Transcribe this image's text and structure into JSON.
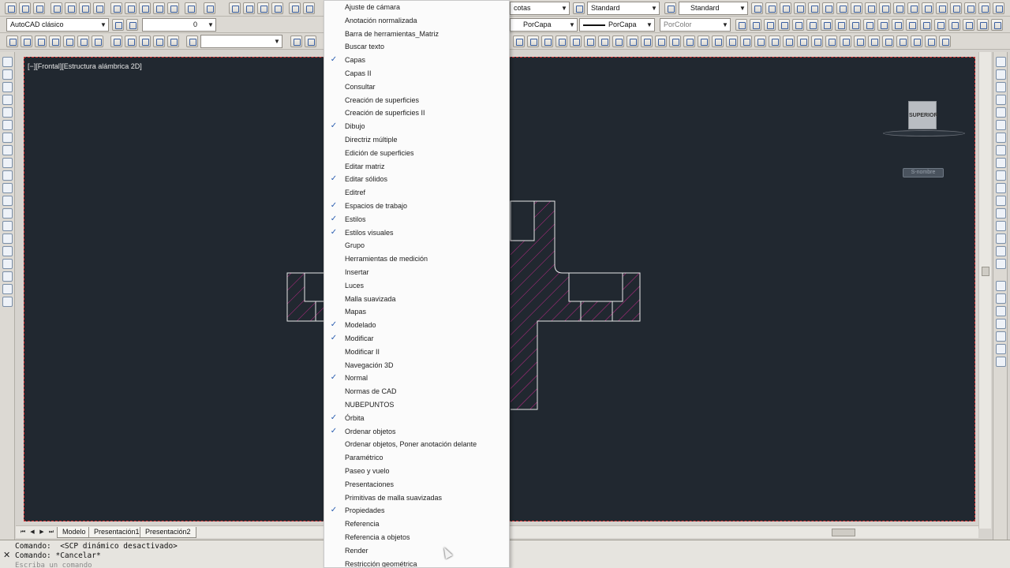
{
  "toolbar": {
    "workspace": "AutoCAD clásico",
    "layer_value": "0",
    "blank_combo": "",
    "text_style": "Standard",
    "dim_style_partial": "cotas",
    "table_style": "Standard",
    "color": "PorCapa",
    "linetype": "PorCapa",
    "lineweight": "PorColor"
  },
  "viewport": {
    "label": "[−][Frontal][Estructura alámbrica 2D]",
    "viewcube_label": "SUPERIOR",
    "wcs_label": "S-nombre"
  },
  "tabs": [
    "Modelo",
    "Presentación1",
    "Presentación2"
  ],
  "command": {
    "line1": "Comando:  <SCP dinámico desactivado>",
    "line2": "Comando: *Cancelar*",
    "placeholder": "Escriba un comando"
  },
  "menu": {
    "items": [
      {
        "label": "Ajuste de cámara",
        "checked": false
      },
      {
        "label": "Anotación normalizada",
        "checked": false
      },
      {
        "label": "Barra de herramientas_Matriz",
        "checked": false
      },
      {
        "label": "Buscar texto",
        "checked": false
      },
      {
        "label": "Capas",
        "checked": true
      },
      {
        "label": "Capas II",
        "checked": false
      },
      {
        "label": "Consultar",
        "checked": false
      },
      {
        "label": "Creación de superficies",
        "checked": false
      },
      {
        "label": "Creación de superficies II",
        "checked": false
      },
      {
        "label": "Dibujo",
        "checked": true
      },
      {
        "label": "Directriz múltiple",
        "checked": false
      },
      {
        "label": "Edición de superficies",
        "checked": false
      },
      {
        "label": "Editar matriz",
        "checked": false
      },
      {
        "label": "Editar sólidos",
        "checked": true
      },
      {
        "label": "Editref",
        "checked": false
      },
      {
        "label": "Espacios de trabajo",
        "checked": true
      },
      {
        "label": "Estilos",
        "checked": true
      },
      {
        "label": "Estilos visuales",
        "checked": true
      },
      {
        "label": "Grupo",
        "checked": false
      },
      {
        "label": "Herramientas de medición",
        "checked": false
      },
      {
        "label": "Insertar",
        "checked": false
      },
      {
        "label": "Luces",
        "checked": false
      },
      {
        "label": "Malla suavizada",
        "checked": false
      },
      {
        "label": "Mapas",
        "checked": false
      },
      {
        "label": "Modelado",
        "checked": true
      },
      {
        "label": "Modificar",
        "checked": true
      },
      {
        "label": "Modificar II",
        "checked": false
      },
      {
        "label": "Navegación 3D",
        "checked": false
      },
      {
        "label": "Normal",
        "checked": true
      },
      {
        "label": "Normas de CAD",
        "checked": false
      },
      {
        "label": "NUBEPUNTOS",
        "checked": false
      },
      {
        "label": "Órbita",
        "checked": true
      },
      {
        "label": "Ordenar objetos",
        "checked": true
      },
      {
        "label": "Ordenar objetos, Poner anotación delante",
        "checked": false
      },
      {
        "label": "Paramétrico",
        "checked": false
      },
      {
        "label": "Paseo y vuelo",
        "checked": false
      },
      {
        "label": "Presentaciones",
        "checked": false
      },
      {
        "label": "Primitivas de malla suavizadas",
        "checked": false
      },
      {
        "label": "Propiedades",
        "checked": true
      },
      {
        "label": "Referencia",
        "checked": false
      },
      {
        "label": "Referencia a objetos",
        "checked": false
      },
      {
        "label": "Render",
        "checked": false
      },
      {
        "label": "Restricción geométrica",
        "checked": false
      }
    ]
  },
  "colors": {
    "canvas": "#212830",
    "hatch": "#c02a8a",
    "menu_check": "#2a5db0"
  }
}
